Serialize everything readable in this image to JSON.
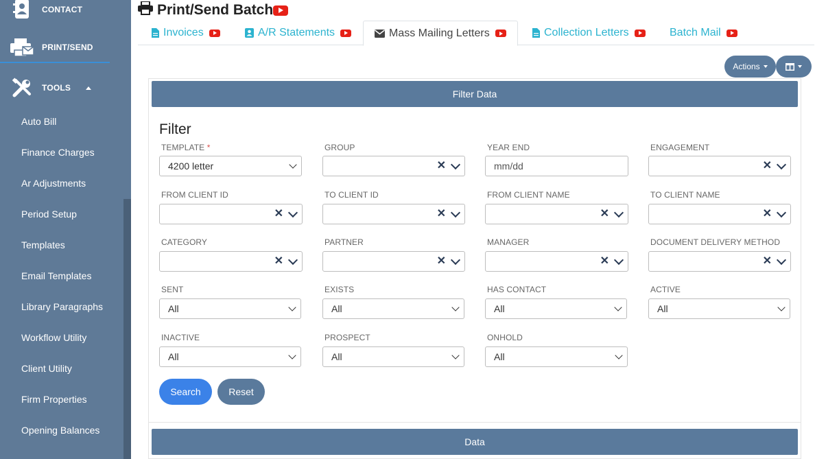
{
  "sidebar": {
    "main_items": [
      {
        "label": "CONTACT",
        "icon": "contact-book-icon"
      },
      {
        "label": "PRINT/SEND",
        "icon": "print-send-icon"
      },
      {
        "label": "TOOLS",
        "icon": "tools-icon"
      }
    ],
    "sub_items": [
      "Auto Bill",
      "Finance Charges",
      "Ar Adjustments",
      "Period Setup",
      "Templates",
      "Email Templates",
      "Library Paragraphs",
      "Workflow Utility",
      "Client Utility",
      "Firm Properties",
      "Opening Balances"
    ]
  },
  "header": {
    "title": "Print/Send Batch",
    "video_icon": "youtube-icon"
  },
  "tabs": [
    {
      "label": "Invoices",
      "icon": "file-icon"
    },
    {
      "label": "A/R Statements",
      "icon": "contact-card-icon"
    },
    {
      "label": "Mass Mailing Letters",
      "icon": "envelope-icon",
      "active": true
    },
    {
      "label": "Collection Letters",
      "icon": "file-icon"
    },
    {
      "label": "Batch Mail",
      "icon": ""
    }
  ],
  "toolbar": {
    "actions_label": "Actions",
    "columns_icon": "columns-icon"
  },
  "filter_bar": "Filter Data",
  "data_bar": "Data",
  "filter": {
    "title": "Filter",
    "fields": [
      {
        "label": "TEMPLATE",
        "required": true,
        "value": "4200 letter",
        "kind": "select"
      },
      {
        "label": "GROUP",
        "value": "",
        "kind": "multi"
      },
      {
        "label": "YEAR END",
        "placeholder": "mm/dd",
        "kind": "text"
      },
      {
        "label": "ENGAGEMENT",
        "value": "",
        "kind": "multi"
      },
      {
        "label": "FROM CLIENT ID",
        "value": "",
        "kind": "multi"
      },
      {
        "label": "TO CLIENT ID",
        "value": "",
        "kind": "multi"
      },
      {
        "label": "FROM CLIENT NAME",
        "value": "",
        "kind": "multi"
      },
      {
        "label": "TO CLIENT NAME",
        "value": "",
        "kind": "multi"
      },
      {
        "label": "CATEGORY",
        "value": "",
        "kind": "multi"
      },
      {
        "label": "PARTNER",
        "value": "",
        "kind": "multi"
      },
      {
        "label": "MANAGER",
        "value": "",
        "kind": "multi"
      },
      {
        "label": "DOCUMENT DELIVERY METHOD",
        "value": "",
        "kind": "multi"
      },
      {
        "label": "SENT",
        "value": "All",
        "kind": "select"
      },
      {
        "label": "EXISTS",
        "value": "All",
        "kind": "select"
      },
      {
        "label": "HAS CONTACT",
        "value": "All",
        "kind": "select"
      },
      {
        "label": "ACTIVE",
        "value": "All",
        "kind": "select"
      },
      {
        "label": "INACTIVE",
        "value": "All",
        "kind": "select"
      },
      {
        "label": "PROSPECT",
        "value": "All",
        "kind": "select"
      },
      {
        "label": "ONHOLD",
        "value": "All",
        "kind": "select"
      }
    ],
    "search_label": "Search",
    "reset_label": "Reset"
  },
  "colors": {
    "sidebar": "#5f7a97",
    "accent_blue": "#3b82e8",
    "tab_link": "#2bb3cf",
    "bar": "#5a7a9c",
    "youtube_red": "#e62117"
  }
}
